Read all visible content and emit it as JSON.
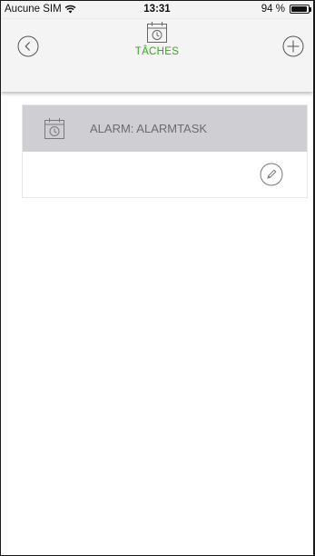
{
  "status_bar": {
    "carrier": "Aucune SIM",
    "time": "13:31",
    "battery": "94 %",
    "battery_level": 0.94
  },
  "nav": {
    "title": "TÂCHES",
    "title_color": "#3aa81e",
    "back_icon": "back-arrow-circle-icon",
    "add_icon": "plus-circle-icon",
    "center_icon": "calendar-clock-icon"
  },
  "tasks": [
    {
      "name": "ALARM: ALARMTASK",
      "icon": "calendar-clock-icon",
      "action_icon": "pencil-edit-icon"
    }
  ]
}
